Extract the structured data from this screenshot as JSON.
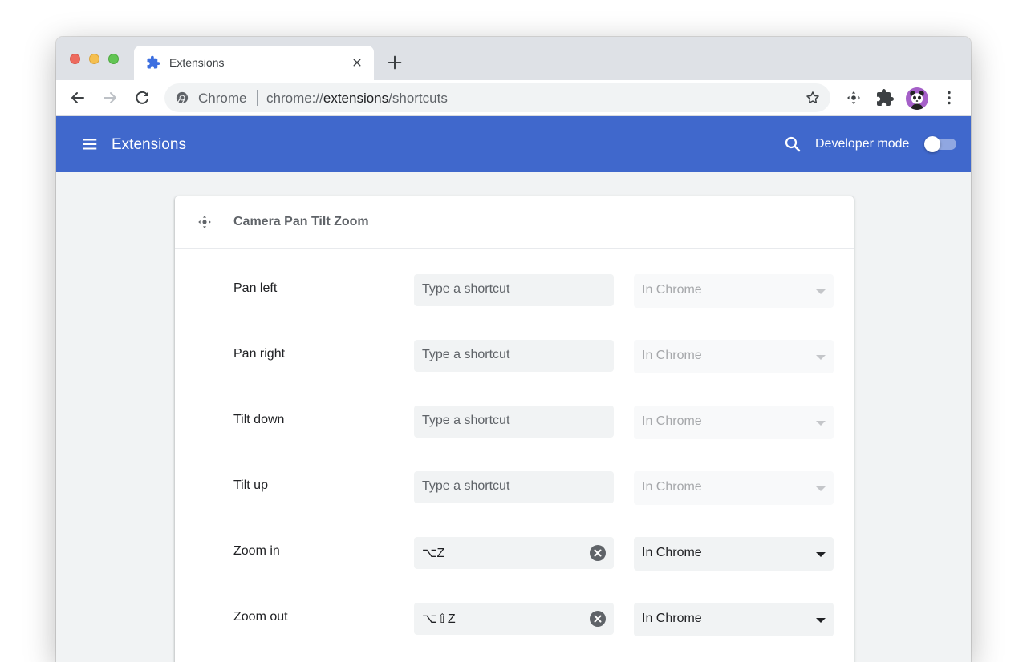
{
  "browser": {
    "tab_title": "Extensions",
    "omnibox_origin": "Chrome",
    "url_prefix": "chrome://",
    "url_host": "extensions",
    "url_path": "/shortcuts"
  },
  "header": {
    "title": "Extensions",
    "developer_mode_label": "Developer mode",
    "developer_mode_on": false
  },
  "extension": {
    "name": "Camera Pan Tilt Zoom",
    "commands": [
      {
        "label": "Pan left",
        "shortcut": "",
        "placeholder": "Type a shortcut",
        "scope": "In Chrome",
        "enabled": false
      },
      {
        "label": "Pan right",
        "shortcut": "",
        "placeholder": "Type a shortcut",
        "scope": "In Chrome",
        "enabled": false
      },
      {
        "label": "Tilt down",
        "shortcut": "",
        "placeholder": "Type a shortcut",
        "scope": "In Chrome",
        "enabled": false
      },
      {
        "label": "Tilt up",
        "shortcut": "",
        "placeholder": "Type a shortcut",
        "scope": "In Chrome",
        "enabled": false
      },
      {
        "label": "Zoom in",
        "shortcut": "⌥Z",
        "placeholder": "Type a shortcut",
        "scope": "In Chrome",
        "enabled": true
      },
      {
        "label": "Zoom out",
        "shortcut": "⌥⇧Z",
        "placeholder": "Type a shortcut",
        "scope": "In Chrome",
        "enabled": true
      }
    ]
  },
  "colors": {
    "header_blue": "#4068cc",
    "tab_strip": "#dee1e6",
    "page_background": "#f1f3f4",
    "avatar_purple": "#a560c8"
  },
  "icons": {
    "tab_favicon": "puzzle-piece-icon",
    "extension": "pan-tilt-move-icon",
    "clear": "clear-circle-icon"
  }
}
